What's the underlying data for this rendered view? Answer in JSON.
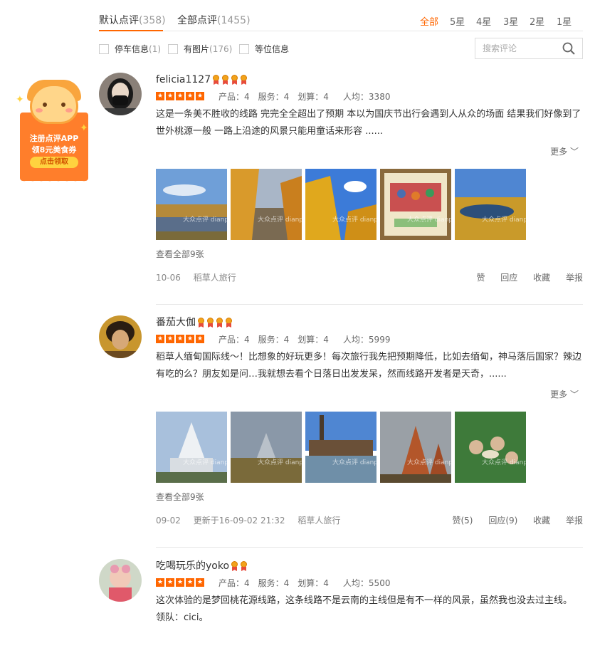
{
  "promo": {
    "line1": "注册点评APP",
    "line2": "领8元美食券",
    "button": "点击领取"
  },
  "tabs": [
    {
      "label": "默认点评",
      "count": "(358)"
    },
    {
      "label": "全部点评",
      "count": "(1455)"
    }
  ],
  "star_filters": [
    "全部",
    "5星",
    "4星",
    "3星",
    "2星",
    "1星"
  ],
  "filters": [
    {
      "label": "停车信息",
      "count": "(1)"
    },
    {
      "label": "有图片",
      "count": "(176)"
    },
    {
      "label": "等位信息",
      "count": ""
    }
  ],
  "search": {
    "placeholder": "搜索评论"
  },
  "reviews": [
    {
      "user": "felicia1127",
      "medals": 4,
      "rating": {
        "product": "产品：4",
        "service": "服务：4",
        "value": "划算：4",
        "avg": "人均：3380"
      },
      "text": "这是一条美不胜收的线路 完完全全超出了预期 本以为国庆节出行会遇到人从众的场面 结果我们好像到了世外桃源一般 一路上沿途的风景只能用童话来形容 ......",
      "more": "更多",
      "view_all": "查看全部9张",
      "date": "10-06",
      "updated": "",
      "shop": "稻草人旅行",
      "actions": [
        "赞",
        "回应",
        "收藏",
        "举报"
      ]
    },
    {
      "user": "番茄大伽",
      "medals": 4,
      "rating": {
        "product": "产品：4",
        "service": "服务：4",
        "value": "划算：4",
        "avg": "人均：5999"
      },
      "text": "稻草人缅甸国际线～！比想象的好玩更多！每次旅行我先把预期降低，比如去缅甸，神马落后国家？辣边有吃的么？朋友如是问…我就想去看个日落日出发发呆，然而线路开发者是天奇，......",
      "more": "更多",
      "view_all": "查看全部9张",
      "date": "09-02",
      "updated": "更新于16-09-02 21:32",
      "shop": "稻草人旅行",
      "actions": [
        "赞(5)",
        "回应(9)",
        "收藏",
        "举报"
      ]
    },
    {
      "user": "吃喝玩乐的yoko",
      "medals": 2,
      "rating": {
        "product": "产品：4",
        "service": "服务：4",
        "value": "划算：4",
        "avg": "人均：5500"
      },
      "text": "这次体验的是梦回桃花源线路，这条线路不是云南的主线但是有不一样的风景，虽然我也没去过主线。",
      "text2": "领队：cici。"
    }
  ],
  "watermark": "大众点评 dianping.com",
  "colors": {
    "accent": "#ff6600",
    "text": "#333333",
    "muted": "#999999"
  }
}
